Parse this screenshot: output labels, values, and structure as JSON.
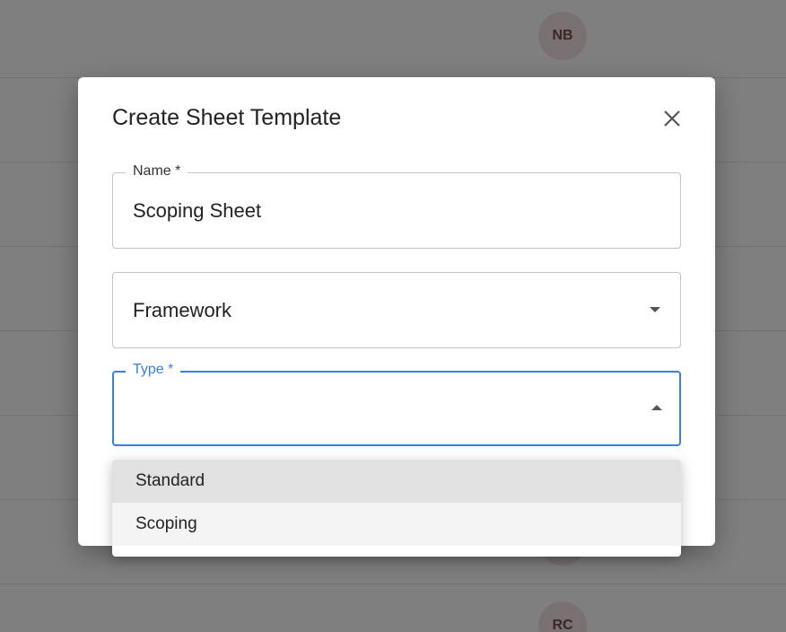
{
  "background": {
    "avatars": [
      "NB",
      "RC"
    ]
  },
  "dialog": {
    "title": "Create Sheet Template",
    "close_icon": "close-icon",
    "fields": {
      "name": {
        "label": "Name *",
        "value": "Scoping Sheet"
      },
      "framework": {
        "placeholder": "Framework"
      },
      "type": {
        "label": "Type *",
        "value": ""
      }
    }
  },
  "type_menu": {
    "options": [
      "Standard",
      "Scoping"
    ],
    "selected": "Standard"
  },
  "colors": {
    "accent": "#3d7fd6",
    "menu_selected": "#e1e1e1",
    "menu_hover": "#f4f4f4"
  }
}
